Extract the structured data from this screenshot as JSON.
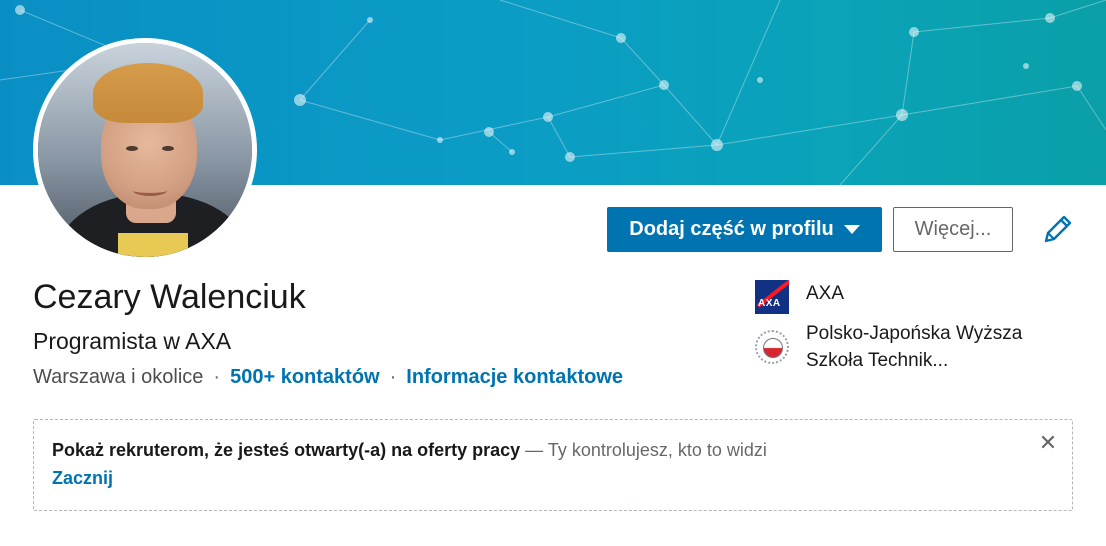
{
  "profile": {
    "name": "Cezary Walenciuk",
    "headline": "Programista w AXA",
    "location": "Warszawa i okolice",
    "separator": "·",
    "connections_link": "500+ kontaktów",
    "contact_info_link": "Informacje kontaktowe"
  },
  "actions": {
    "add_section_label": "Dodaj część w profilu",
    "more_label": "Więcej...",
    "edit_icon": "pencil-icon"
  },
  "sidebar": {
    "items": [
      {
        "label": "AXA",
        "icon": "axa-logo"
      },
      {
        "label_line1": "Polsko-Japońska Wyższa",
        "label_line2": "Szkoła Technik...",
        "icon": "pjatk-logo"
      }
    ]
  },
  "promo": {
    "strong_text": "Pokaż rekruterom, że jesteś otwarty(-a) na oferty pracy",
    "rest_text": " — Ty kontrolujesz, kto to widzi",
    "start_link": "Zacznij",
    "close_glyph": "✕"
  },
  "colors": {
    "brand_blue": "#0073b1",
    "banner_teal": "#0a9fb8"
  }
}
